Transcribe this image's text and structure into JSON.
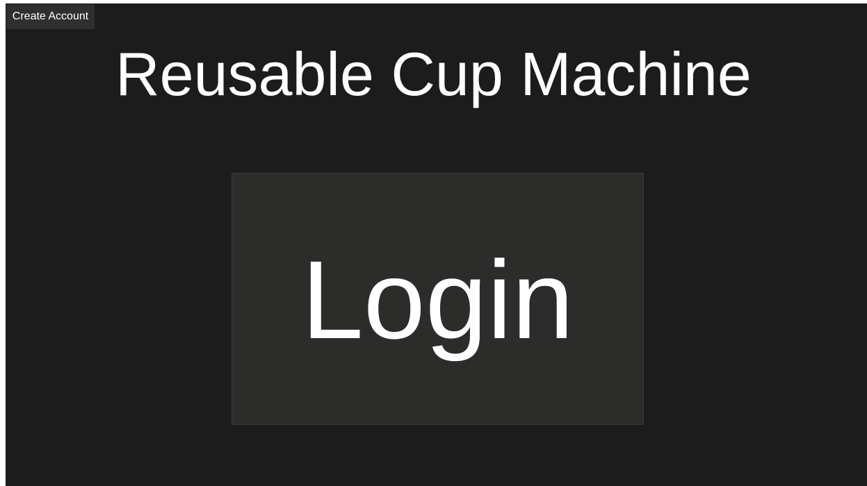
{
  "header": {
    "create_account_label": "Create Account",
    "title": "Reusable Cup Machine"
  },
  "main": {
    "login_label": "Login"
  },
  "colors": {
    "background": "#1c1c1c",
    "button_background": "#2c2c2b",
    "small_button_background": "#2f2f2f",
    "text": "#ffffff"
  }
}
